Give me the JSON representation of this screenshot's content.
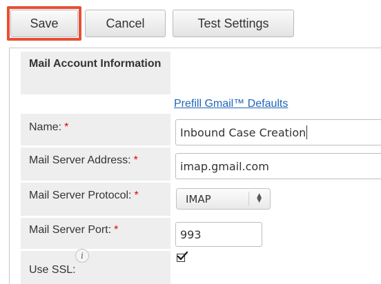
{
  "toolbar": {
    "save_label": "Save",
    "cancel_label": "Cancel",
    "test_label": "Test Settings",
    "highlight_color": "#e94e34"
  },
  "section": {
    "title": "Mail Account Information"
  },
  "prefill_link": "Prefill Gmail™ Defaults",
  "fields": {
    "name": {
      "label": "Name:",
      "required": "*",
      "value": "Inbound Case Creation"
    },
    "server_address": {
      "label": "Mail Server Address:",
      "required": "*",
      "value": "imap.gmail.com"
    },
    "protocol": {
      "label": "Mail Server Protocol:",
      "required": "*",
      "selected": "IMAP"
    },
    "port": {
      "label": "Mail Server Port:",
      "required": "*",
      "value": "993"
    },
    "ssl": {
      "label": "Use SSL:",
      "info_icon": "info-icon",
      "checked": true
    }
  }
}
